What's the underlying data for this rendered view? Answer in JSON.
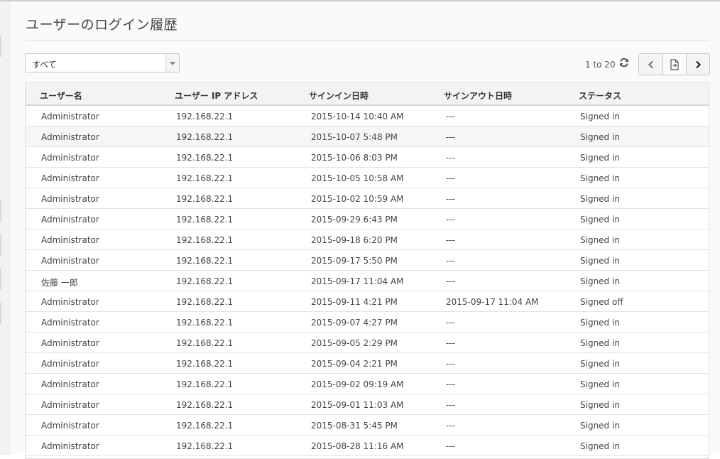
{
  "page": {
    "title": "ユーザーのログイン履歴"
  },
  "filter": {
    "selected": "すべて"
  },
  "pager": {
    "range_text": "1 to 20"
  },
  "icons": {
    "refresh": "refresh-icon",
    "prev": "chevron-left-icon",
    "export": "export-document-icon",
    "next": "chevron-right-icon"
  },
  "table": {
    "headers": [
      "ユーザー名",
      "ユーザー IP アドレス",
      "サインイン日時",
      "サインアウト日時",
      "ステータス"
    ],
    "rows": [
      [
        "Administrator",
        "192.168.22.1",
        "2015-10-14 10:40 AM",
        "---",
        "Signed in"
      ],
      [
        "Administrator",
        "192.168.22.1",
        "2015-10-07 5:48 PM",
        "---",
        "Signed in"
      ],
      [
        "Administrator",
        "192.168.22.1",
        "2015-10-06 8:03 PM",
        "---",
        "Signed in"
      ],
      [
        "Administrator",
        "192.168.22.1",
        "2015-10-05 10:58 AM",
        "---",
        "Signed in"
      ],
      [
        "Administrator",
        "192.168.22.1",
        "2015-10-02 10:59 AM",
        "---",
        "Signed in"
      ],
      [
        "Administrator",
        "192.168.22.1",
        "2015-09-29 6:43 PM",
        "---",
        "Signed in"
      ],
      [
        "Administrator",
        "192.168.22.1",
        "2015-09-18 6:20 PM",
        "---",
        "Signed in"
      ],
      [
        "Administrator",
        "192.168.22.1",
        "2015-09-17 5:50 PM",
        "---",
        "Signed in"
      ],
      [
        "佐藤 一郎",
        "192.168.22.1",
        "2015-09-17 11:04 AM",
        "---",
        "Signed in"
      ],
      [
        "Administrator",
        "192.168.22.1",
        "2015-09-11 4:21 PM",
        "2015-09-17 11:04 AM",
        "Signed off"
      ],
      [
        "Administrator",
        "192.168.22.1",
        "2015-09-07 4:27 PM",
        "---",
        "Signed in"
      ],
      [
        "Administrator",
        "192.168.22.1",
        "2015-09-05 2:29 PM",
        "---",
        "Signed in"
      ],
      [
        "Administrator",
        "192.168.22.1",
        "2015-09-04 2:21 PM",
        "---",
        "Signed in"
      ],
      [
        "Administrator",
        "192.168.22.1",
        "2015-09-02 09:19 AM",
        "---",
        "Signed in"
      ],
      [
        "Administrator",
        "192.168.22.1",
        "2015-09-01 11:03 AM",
        "---",
        "Signed in"
      ],
      [
        "Administrator",
        "192.168.22.1",
        "2015-08-31 5:45 PM",
        "---",
        "Signed in"
      ],
      [
        "Administrator",
        "192.168.22.1",
        "2015-08-28 11:16 AM",
        "---",
        "Signed in"
      ]
    ]
  }
}
